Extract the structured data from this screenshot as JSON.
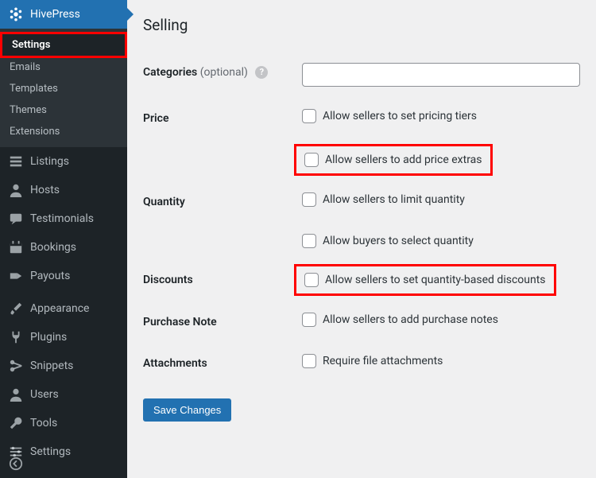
{
  "sidebar": {
    "top": {
      "label": "HivePress"
    },
    "submenu": [
      {
        "label": "Settings",
        "current": true,
        "highlight": true
      },
      {
        "label": "Emails"
      },
      {
        "label": "Templates"
      },
      {
        "label": "Themes"
      },
      {
        "label": "Extensions"
      }
    ],
    "menu": [
      {
        "label": "Listings",
        "icon": "list"
      },
      {
        "label": "Hosts",
        "icon": "user"
      },
      {
        "label": "Testimonials",
        "icon": "testimonial"
      },
      {
        "label": "Bookings",
        "icon": "calendar"
      },
      {
        "label": "Payouts",
        "icon": "payout"
      }
    ],
    "menu2": [
      {
        "label": "Appearance",
        "icon": "brush"
      },
      {
        "label": "Plugins",
        "icon": "plug"
      },
      {
        "label": "Snippets",
        "icon": "scissors"
      },
      {
        "label": "Users",
        "icon": "users"
      },
      {
        "label": "Tools",
        "icon": "wrench"
      },
      {
        "label": "Settings",
        "icon": "sliders"
      }
    ]
  },
  "content": {
    "section_title": "Selling",
    "rows": {
      "categories": {
        "label": "Categories",
        "optional": "(optional)"
      },
      "price": {
        "label": "Price",
        "opt1": "Allow sellers to set pricing tiers",
        "opt2": "Allow sellers to add price extras"
      },
      "quantity": {
        "label": "Quantity",
        "opt1": "Allow sellers to limit quantity",
        "opt2": "Allow buyers to select quantity"
      },
      "discounts": {
        "label": "Discounts",
        "opt1": "Allow sellers to set quantity-based discounts"
      },
      "purchase_note": {
        "label": "Purchase Note",
        "opt1": "Allow sellers to add purchase notes"
      },
      "attachments": {
        "label": "Attachments",
        "opt1": "Require file attachments"
      }
    },
    "save": "Save Changes"
  }
}
